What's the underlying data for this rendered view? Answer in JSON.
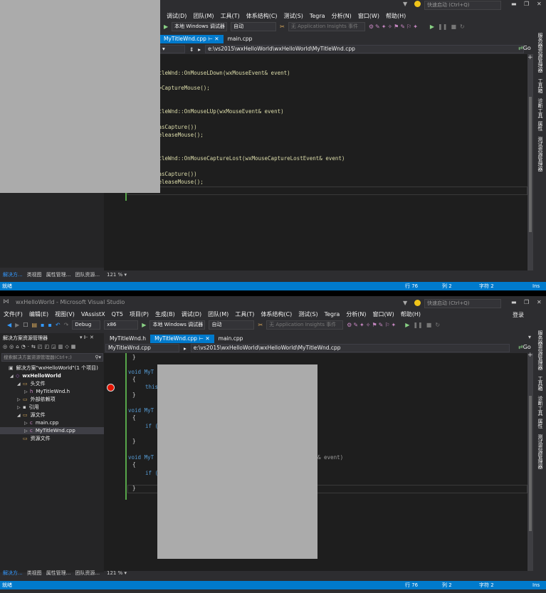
{
  "colors": {
    "accent": "#007acc",
    "background": "#2d2d30",
    "editor": "#1e1e1e",
    "overlay": "#ababab",
    "breakpoint": "#e51400"
  },
  "top": {
    "menu": [
      "调试(D)",
      "团队(M)",
      "工具(T)",
      "体系结构(C)",
      "测试(S)",
      "Tegra",
      "分析(N)",
      "窗口(W)",
      "帮助(H)"
    ],
    "quick_launch": "快速启动 (Ctrl+Q)",
    "debugger_target": "本地 Windows 调试器",
    "debugger_mode": "自动",
    "insights": "无 Application Insights 事件",
    "tabs": [
      "MyTitleWnd.cpp",
      "main.cpp"
    ],
    "nav_path": "e:\\vs2015\\wxHelloWorld\\wxHelloWorld\\MyTitleWnd.cpp",
    "go_label": "Go",
    "code": [
      "itleWnd::OnMouseLDown(wxMouseEvent& event)",
      "->CaptureMouse();",
      "itleWnd::OnMouseLUp(wxMouseEvent& event)",
      "HasCapture())",
      "ReleaseMouse();",
      "itleWnd::OnMouseCaptureLost(wxMouseCaptureLostEvent& event)",
      "HasCapture())",
      "ReleaseMouse();"
    ],
    "side_tabs": [
      "解决方...",
      "类视图",
      "属性管理...",
      "团队资源..."
    ],
    "zoom": "121 %",
    "status": "就绪",
    "line": "行 76",
    "col": "列 2",
    "char": "字符 2",
    "ins": "Ins",
    "right_dock": [
      "服务器资源管理器",
      "工具箱",
      "诊断工具",
      "属性",
      "测试资源管理器"
    ]
  },
  "bottom": {
    "window_title": "wxHelloWorld - Microsoft Visual Studio",
    "quick_launch": "快速启动 (Ctrl+Q)",
    "login": "登录",
    "menu": [
      "文件(F)",
      "编辑(E)",
      "视图(V)",
      "VAssistX",
      "QT5",
      "项目(P)",
      "生成(B)",
      "调试(D)",
      "团队(M)",
      "工具(T)",
      "体系结构(C)",
      "测试(S)",
      "Tegra",
      "分析(N)",
      "窗口(W)",
      "帮助(H)"
    ],
    "config": "Debug",
    "platform": "x86",
    "debugger_target": "本地 Windows 调试器",
    "debugger_mode": "自动",
    "insights": "无 Application Insights 事件",
    "solution_explorer_title": "解决方案资源管理器",
    "search_placeholder": "搜索解决方案资源管理器(Ctrl+;)",
    "tree": [
      {
        "label": "解决方案\"wxHelloWorld\"(1 个项目)",
        "indent": 0,
        "arrow": ""
      },
      {
        "label": "wxHelloWorld",
        "indent": 1,
        "arrow": "◢"
      },
      {
        "label": "头文件",
        "indent": 2,
        "arrow": "◢"
      },
      {
        "label": "MyTitleWnd.h",
        "indent": 3,
        "arrow": "▷"
      },
      {
        "label": "外部依赖项",
        "indent": 2,
        "arrow": "▷"
      },
      {
        "label": "引用",
        "indent": 2,
        "arrow": "▷"
      },
      {
        "label": "源文件",
        "indent": 2,
        "arrow": "◢"
      },
      {
        "label": "main.cpp",
        "indent": 3,
        "arrow": "▷"
      },
      {
        "label": "MyTitleWnd.cpp",
        "indent": 3,
        "arrow": "▷"
      },
      {
        "label": "资源文件",
        "indent": 2,
        "arrow": ""
      }
    ],
    "tabs": [
      "MyTitleWnd.h",
      "MyTitleWnd.cpp",
      "main.cpp"
    ],
    "nav_left": "MyTitleWnd.cpp",
    "nav_path": "e:\\vs2015\\wxHelloWorld\\wxHelloWorld\\MyTitleWnd.cpp",
    "go_label": "Go",
    "code": [
      "}",
      "void MyT",
      "{",
      "this",
      "}",
      "void MyT",
      "{",
      "if (",
      "}",
      "void MyT",
      "& event)",
      "{",
      "if (",
      "}"
    ],
    "side_tabs": [
      "解决方...",
      "类视图",
      "属性管理...",
      "团队资源..."
    ],
    "zoom": "121 %",
    "status": "就绪",
    "line": "行 76",
    "col": "列 2",
    "char": "字符 2",
    "ins": "Ins",
    "right_dock": [
      "服务器资源管理器",
      "工具箱",
      "诊断工具",
      "属性",
      "测试资源管理器"
    ]
  }
}
